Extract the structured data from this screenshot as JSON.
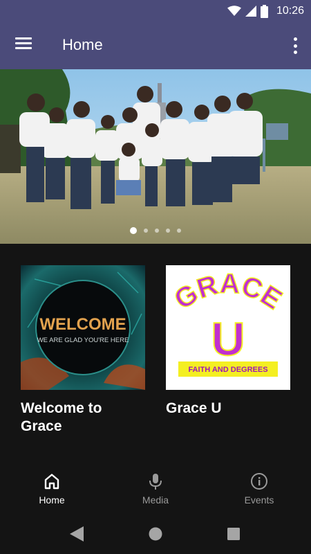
{
  "status_bar": {
    "time": "10:26",
    "icons": [
      "wifi-icon",
      "signal-icon",
      "battery-icon"
    ]
  },
  "app_bar": {
    "title": "Home",
    "menu_icon": "hamburger-menu-icon",
    "overflow_icon": "more-vert-icon",
    "background": "#4b4b7a"
  },
  "hero": {
    "slide_count": 5,
    "active_slide": 1,
    "description_icon": "group-photo"
  },
  "cards": [
    {
      "title": "Welcome to Grace",
      "thumb_text_main": "WELCOME",
      "thumb_text_sub": "WE ARE GLAD YOU'RE HERE"
    },
    {
      "title": "Grace U",
      "thumb_text_main": "GRACE",
      "thumb_letter": "U",
      "thumb_text_sub": "FAITH AND DEGREES"
    }
  ],
  "bottom_nav": {
    "items": [
      {
        "label": "Home",
        "icon": "home-icon",
        "active": true
      },
      {
        "label": "Media",
        "icon": "microphone-icon",
        "active": false
      },
      {
        "label": "Events",
        "icon": "info-icon",
        "active": false
      }
    ]
  },
  "system_nav": {
    "icons": [
      "back-icon",
      "home-circle-icon",
      "recents-icon"
    ]
  },
  "colors": {
    "accent": "#4b4b7a",
    "background": "#141414",
    "grace_purple": "#c12fcf",
    "grace_yellow": "#f4ef22"
  }
}
